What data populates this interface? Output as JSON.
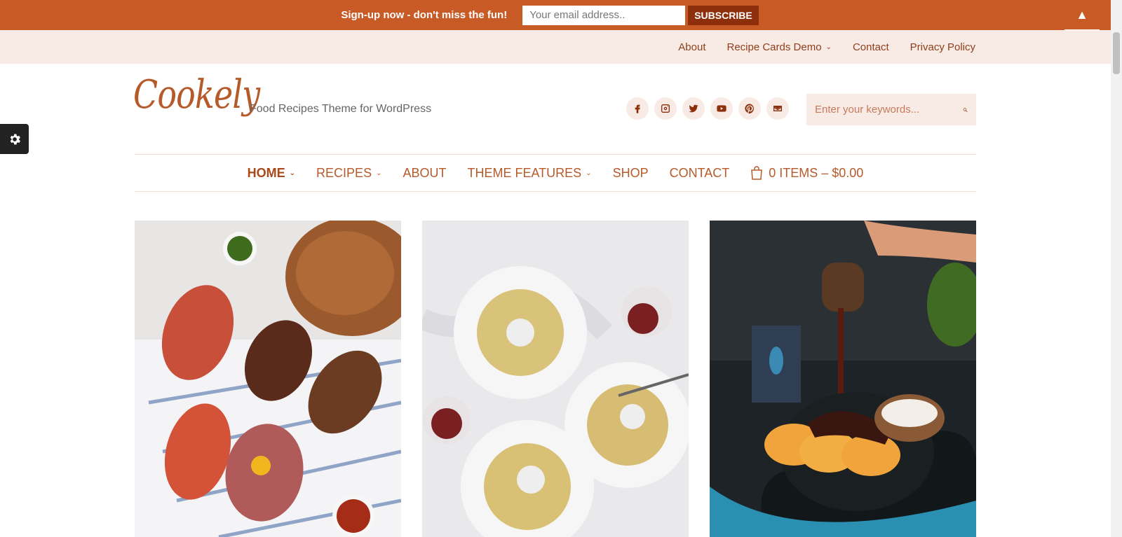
{
  "signup": {
    "text": "Sign-up now - don't miss the fun!",
    "email_placeholder": "Your email address..",
    "subscribe_label": "SUBSCRIBE",
    "toggle_glyph": "▲"
  },
  "top_nav": {
    "items": [
      {
        "label": "About"
      },
      {
        "label": "Recipe Cards Demo",
        "has_dropdown": true
      },
      {
        "label": "Contact"
      },
      {
        "label": "Privacy Policy"
      }
    ]
  },
  "header": {
    "logo": "Cookely",
    "tagline": "Food Recipes Theme for WordPress",
    "social_icons": [
      "facebook-icon",
      "instagram-icon",
      "twitter-icon",
      "youtube-icon",
      "pinterest-icon",
      "email-icon"
    ],
    "search_placeholder": "Enter your keywords..."
  },
  "main_nav": {
    "items": [
      {
        "label": "HOME",
        "active": true,
        "has_dropdown": true
      },
      {
        "label": "RECIPES",
        "has_dropdown": true
      },
      {
        "label": "ABOUT"
      },
      {
        "label": "THEME FEATURES",
        "has_dropdown": true
      },
      {
        "label": "SHOP"
      },
      {
        "label": "CONTACT"
      }
    ],
    "cart_label": "0 ITEMS – $0.00"
  },
  "posts": [
    {
      "image": "bruschetta-photo"
    },
    {
      "image": "spaghetti-photo"
    },
    {
      "image": "pancakes-syrup-photo"
    }
  ],
  "colors": {
    "accent": "#c85a25",
    "accent_dark": "#8e2f0b",
    "nav_text": "#b65a2a",
    "soft_bg": "#f8eae5"
  }
}
